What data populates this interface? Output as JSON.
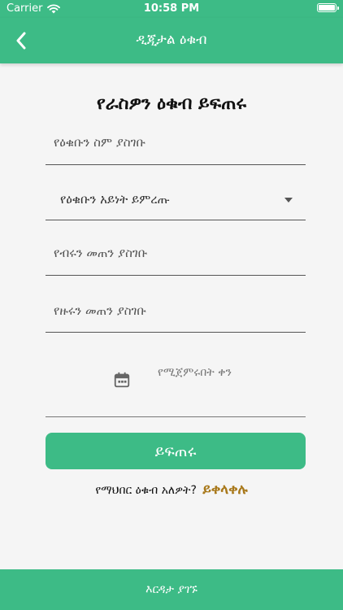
{
  "status_bar": {
    "carrier": "Carrier",
    "time": "10:58 PM"
  },
  "nav": {
    "title": "ዲጂታል ዕቁብ"
  },
  "form": {
    "title": "የራስዎን ዕቁብ ይፍጠሩ",
    "name_placeholder": "የዕቁቡን ስም ያስገቡ",
    "type_select": "የዕቁቡን አይነት ይምረጡ",
    "amount_placeholder": "የብሩን መጠን ያስገቡ",
    "round_placeholder": "የዙሩን መጠን ያስገቡ",
    "start_date_label": "የሚጀምሩበት ቀን",
    "create_button": "ይፍጠሩ"
  },
  "join": {
    "question": "የማህበር ዕቁብ አለዎት?",
    "link": "ይቀላቀሉ"
  },
  "bottom_bar": {
    "label": "እርዳታ ያገኙ"
  },
  "colors": {
    "primary": "#3dbb86",
    "link": "#a8781a",
    "background": "#f5f5f5"
  },
  "icons": {
    "back": "chevron-left-icon",
    "calendar": "calendar-icon",
    "dropdown": "caret-down-icon",
    "wifi": "wifi-icon",
    "battery": "battery-icon"
  }
}
